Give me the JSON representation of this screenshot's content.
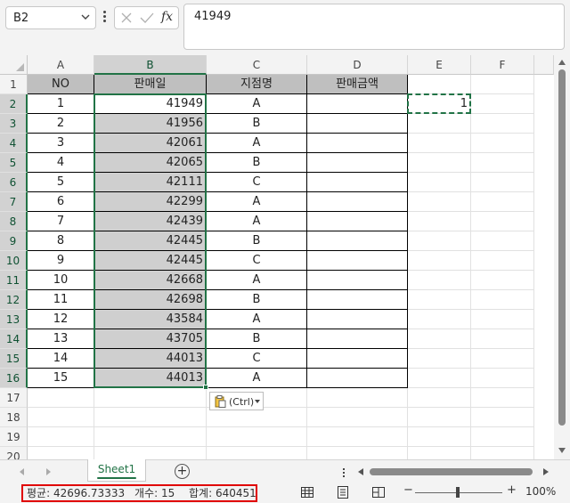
{
  "name_box": {
    "value": "B2"
  },
  "formula_bar": {
    "value": "41949",
    "fx_label": "fx"
  },
  "columns": [
    "A",
    "B",
    "C",
    "D",
    "E",
    "F"
  ],
  "rows": [
    "1",
    "2",
    "3",
    "4",
    "5",
    "6",
    "7",
    "8",
    "9",
    "10",
    "11",
    "12",
    "13",
    "14",
    "15",
    "16",
    "17",
    "18",
    "19",
    "20"
  ],
  "table": {
    "headers": [
      "NO",
      "판매일",
      "지점명",
      "판매금액"
    ],
    "rows": [
      [
        "1",
        "41949",
        "A",
        ""
      ],
      [
        "2",
        "41956",
        "B",
        ""
      ],
      [
        "3",
        "42061",
        "A",
        ""
      ],
      [
        "4",
        "42065",
        "B",
        ""
      ],
      [
        "5",
        "42111",
        "C",
        ""
      ],
      [
        "6",
        "42299",
        "A",
        ""
      ],
      [
        "7",
        "42439",
        "A",
        ""
      ],
      [
        "8",
        "42445",
        "B",
        ""
      ],
      [
        "9",
        "42445",
        "C",
        ""
      ],
      [
        "10",
        "42668",
        "A",
        ""
      ],
      [
        "11",
        "42698",
        "B",
        ""
      ],
      [
        "12",
        "43584",
        "A",
        ""
      ],
      [
        "13",
        "43705",
        "B",
        ""
      ],
      [
        "14",
        "44013",
        "C",
        ""
      ],
      [
        "15",
        "44013",
        "A",
        ""
      ]
    ]
  },
  "copied_cell": {
    "ref": "E2",
    "value": "1"
  },
  "paste_options": {
    "label": "(Ctrl)"
  },
  "sheet_tabs": [
    {
      "label": "Sheet1",
      "active": true
    }
  ],
  "status": {
    "average": "평균: 42696.73333",
    "count": "개수: 15",
    "sum": "합계: 640451",
    "zoom": "100%"
  },
  "colors": {
    "accent": "#217346",
    "header_fill": "#bfbfbf",
    "selection_fill": "#cfcfcf",
    "status_highlight": "#e00000"
  }
}
